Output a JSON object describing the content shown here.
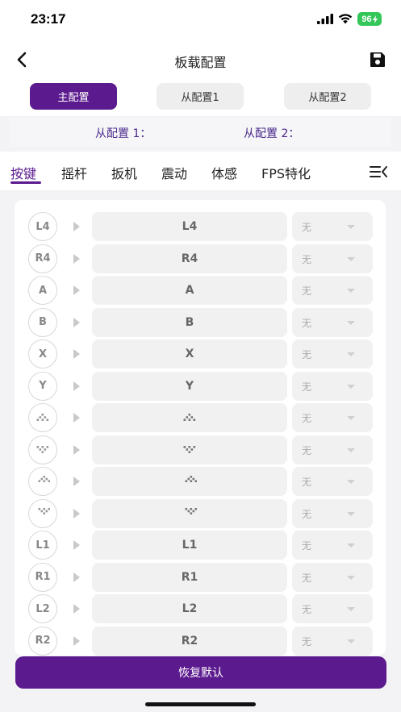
{
  "status": {
    "time": "23:17",
    "battery": "96"
  },
  "header": {
    "title": "板载配置"
  },
  "configs": {
    "main": "主配置",
    "sub1": "从配置1",
    "sub2": "从配置2"
  },
  "sub_info": {
    "sub1": "从配置 1：",
    "sub2": "从配置 2："
  },
  "tabs": [
    "按键",
    "摇杆",
    "扳机",
    "震动",
    "体感",
    "FPS特化"
  ],
  "active_tab": "按键",
  "accent_color": "#5b1a8e",
  "rows": [
    {
      "key": "L4",
      "mapped": "L4",
      "option": "无",
      "icon": ""
    },
    {
      "key": "R4",
      "mapped": "R4",
      "option": "无",
      "icon": ""
    },
    {
      "key": "A",
      "mapped": "A",
      "option": "无",
      "icon": ""
    },
    {
      "key": "B",
      "mapped": "B",
      "option": "无",
      "icon": ""
    },
    {
      "key": "X",
      "mapped": "X",
      "option": "无",
      "icon": ""
    },
    {
      "key": "Y",
      "mapped": "Y",
      "option": "无",
      "icon": ""
    },
    {
      "key": "",
      "mapped": "",
      "option": "无",
      "icon": "dpad-up-icon"
    },
    {
      "key": "",
      "mapped": "",
      "option": "无",
      "icon": "dpad-down-icon"
    },
    {
      "key": "",
      "mapped": "",
      "option": "无",
      "icon": "dpad-left-icon"
    },
    {
      "key": "",
      "mapped": "",
      "option": "无",
      "icon": "dpad-right-icon"
    },
    {
      "key": "L1",
      "mapped": "L1",
      "option": "无",
      "icon": ""
    },
    {
      "key": "R1",
      "mapped": "R1",
      "option": "无",
      "icon": ""
    },
    {
      "key": "L2",
      "mapped": "L2",
      "option": "无",
      "icon": ""
    },
    {
      "key": "R2",
      "mapped": "R2",
      "option": "无",
      "icon": ""
    }
  ],
  "reset_label": "恢复默认"
}
